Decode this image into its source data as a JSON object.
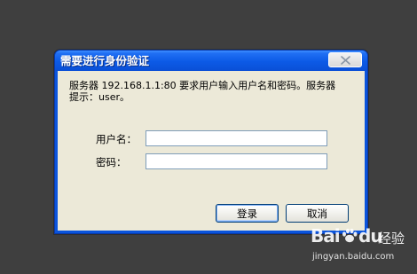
{
  "dialog": {
    "title": "需要进行身份验证",
    "message": "服务器 192.168.1.1:80 要求用户输入用户名和密码。服务器提示：user。",
    "username_label": "用户名：",
    "username_value": "",
    "password_label": "密码：",
    "password_value": "",
    "login_button": "登录",
    "cancel_button": "取消"
  },
  "watermark": {
    "logo_text": "Bai",
    "logo_suffix": "du",
    "brand_text": "经验",
    "url_text": "jingyan.baidu.com"
  },
  "colors": {
    "titlebar": "#0a54dc",
    "client_background": "#ece9d8",
    "page_background": "#3f3f3f",
    "input_border": "#7f9db9",
    "button_border": "#003c74"
  },
  "icons": {
    "close": "close-icon",
    "watermark_paw": "paw-icon"
  }
}
